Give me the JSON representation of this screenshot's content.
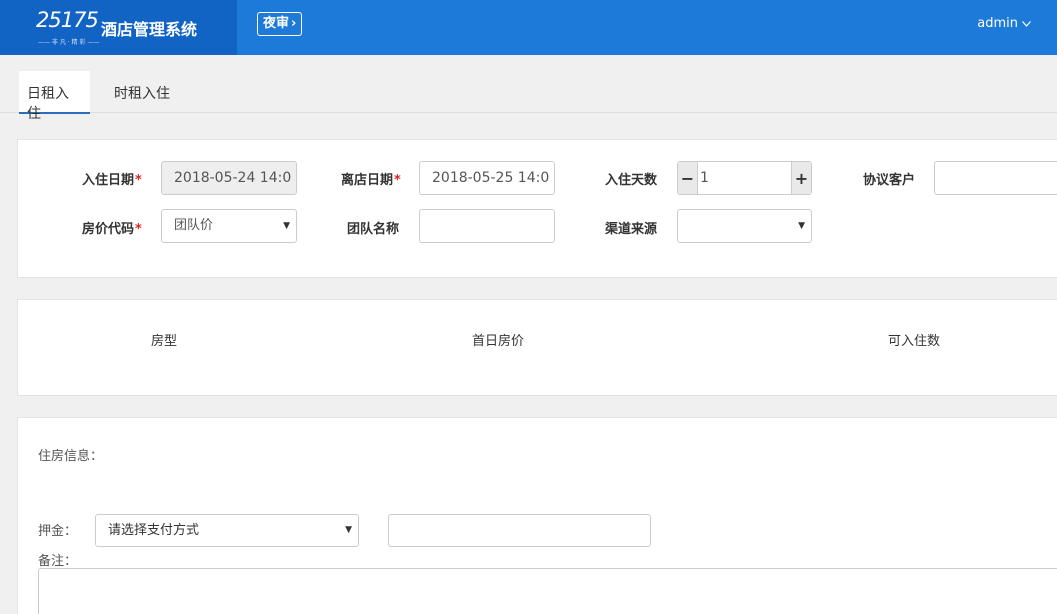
{
  "header": {
    "logo_text": "25175",
    "logo_sub": "——  非 凡 · 精 彩  ——",
    "app_title": "酒店管理系统",
    "night_audit_label": "夜审",
    "user_name": "admin"
  },
  "tabs": [
    {
      "label": "日租入住",
      "active": true
    },
    {
      "label": "时租入住",
      "active": false
    }
  ],
  "form": {
    "checkin_date_label": "入住日期",
    "checkin_date_value": "2018-05-24 14:0",
    "checkout_date_label": "离店日期",
    "checkout_date_value": "2018-05-25 14:0",
    "nights_label": "入住天数",
    "nights_value": "1",
    "agreement_customer_label": "协议客户",
    "agreement_customer_value": "",
    "rate_code_label": "房价代码",
    "rate_code_value": "团队价",
    "group_name_label": "团队名称",
    "group_name_value": "",
    "channel_label": "渠道来源",
    "channel_value": "",
    "required_mark": "*"
  },
  "room_table": {
    "columns": [
      "房型",
      "首日房价",
      "可入住数"
    ]
  },
  "info": {
    "room_info_label": "住房信息：",
    "deposit_label": "押金：",
    "payment_method_placeholder": "请选择支付方式",
    "deposit_amount_value": "",
    "remark_label": "备注："
  },
  "colors": {
    "header_bg": "#1e7ad9",
    "brand_bg": "#1163c4",
    "required": "#dd2222",
    "tab_active_underline": "#2a6ebb"
  }
}
